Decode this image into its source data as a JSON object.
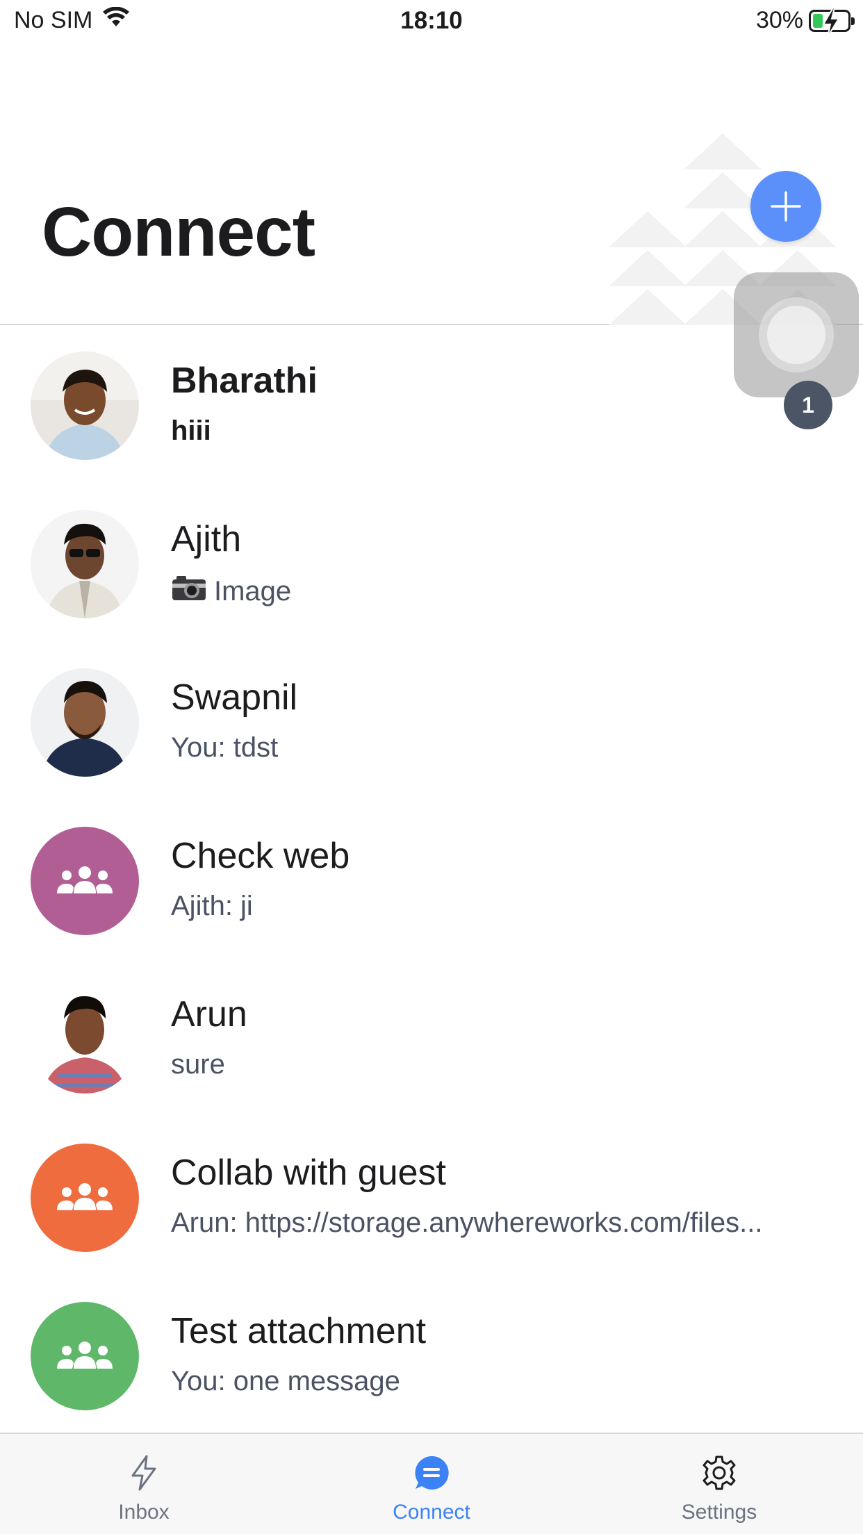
{
  "status_bar": {
    "carrier": "No SIM",
    "time": "18:10",
    "battery": "30%",
    "battery_level": 0.3
  },
  "header": {
    "title": "Connect"
  },
  "assistive_badge": "1",
  "conversations": [
    {
      "name": "Bharathi",
      "message": "hiii",
      "unread": true,
      "avatar_type": "photo",
      "icon": "person-photo"
    },
    {
      "name": "Ajith",
      "message": "Image",
      "message_icon": "camera-icon",
      "unread": false,
      "avatar_type": "photo",
      "icon": "person-photo"
    },
    {
      "name": "Swapnil",
      "message": "You: tdst",
      "unread": false,
      "avatar_type": "photo",
      "icon": "person-photo"
    },
    {
      "name": "Check web",
      "message": "Ajith: ji",
      "unread": false,
      "avatar_type": "group",
      "icon": "group-icon",
      "color": "#b05e94"
    },
    {
      "name": "Arun",
      "message": "sure",
      "unread": false,
      "avatar_type": "photo",
      "icon": "person-photo"
    },
    {
      "name": "Collab with guest",
      "message": "Arun: https://storage.anywhereworks.com/files...",
      "unread": false,
      "avatar_type": "group",
      "icon": "group-icon",
      "color": "#ef6c3e"
    },
    {
      "name": "Test attachment",
      "message": "You: one message",
      "unread": false,
      "avatar_type": "group",
      "icon": "group-icon",
      "color": "#5fb76a"
    }
  ],
  "tabs": [
    {
      "label": "Inbox",
      "icon": "lightning-icon",
      "active": false
    },
    {
      "label": "Connect",
      "icon": "chat-bubble-icon",
      "active": true
    },
    {
      "label": "Settings",
      "icon": "gear-icon",
      "active": false
    }
  ],
  "colors": {
    "accent": "#3b82f6",
    "add_button": "#5b8ff9",
    "badge": "#4b5565"
  }
}
